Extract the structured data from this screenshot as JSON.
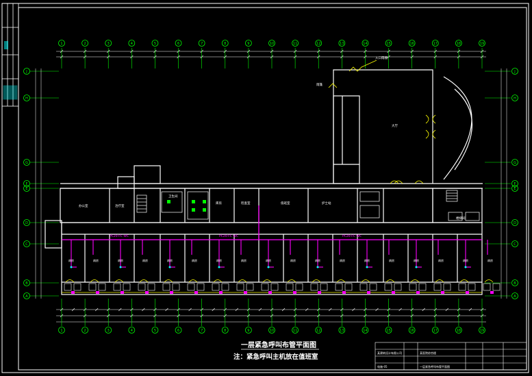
{
  "drawing": {
    "title": "一层紧急呼叫布管平面图",
    "note": "注：紧急呼叫主机放在值班室",
    "colors": {
      "background": "#000000",
      "frame": "#ffffff",
      "axis": "#00ff00",
      "wall": "#ffffff",
      "conduit": "#ff00ff",
      "equipment": "#ffff00",
      "text": "#ffffff",
      "sidebar_text": "#00ffff"
    },
    "column_axes": [
      "1",
      "2",
      "3",
      "4",
      "5",
      "6",
      "7",
      "8",
      "9",
      "10",
      "11",
      "12",
      "13",
      "14",
      "15",
      "16",
      "17",
      "18",
      "19"
    ],
    "row_axes": [
      "J",
      "H",
      "G",
      "F",
      "E",
      "D",
      "C",
      "B",
      "A"
    ],
    "rooms": {
      "hall": "大厅",
      "duty_room": "值班室",
      "office": "办公室",
      "ward": "病房",
      "toilet": "卫生间",
      "stair": "楼梯间",
      "storage": "库房",
      "treatment": "治疗室",
      "nurse_station": "护士站",
      "exam": "检查室"
    },
    "annotations": {
      "entrance_roof": "入口雨棚",
      "canopy": "雨篷"
    },
    "conduit_label": "PC20-FC WC",
    "titleblock": {
      "company": "某建筑设计有限公司",
      "drawing_name": "一层紧急呼叫布管平面图",
      "project": "某医院综合楼",
      "sheet": "电施-05"
    }
  }
}
